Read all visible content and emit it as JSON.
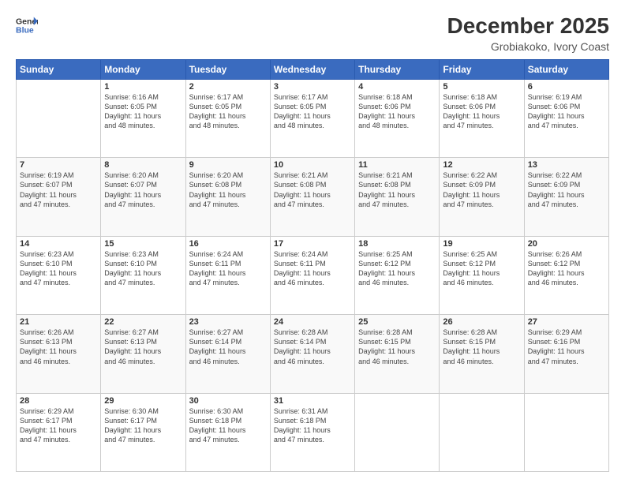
{
  "header": {
    "logo_line1": "General",
    "logo_line2": "Blue",
    "month_year": "December 2025",
    "location": "Grobiakoko, Ivory Coast"
  },
  "weekdays": [
    "Sunday",
    "Monday",
    "Tuesday",
    "Wednesday",
    "Thursday",
    "Friday",
    "Saturday"
  ],
  "weeks": [
    [
      {
        "day": "",
        "info": ""
      },
      {
        "day": "1",
        "info": "Sunrise: 6:16 AM\nSunset: 6:05 PM\nDaylight: 11 hours\nand 48 minutes."
      },
      {
        "day": "2",
        "info": "Sunrise: 6:17 AM\nSunset: 6:05 PM\nDaylight: 11 hours\nand 48 minutes."
      },
      {
        "day": "3",
        "info": "Sunrise: 6:17 AM\nSunset: 6:05 PM\nDaylight: 11 hours\nand 48 minutes."
      },
      {
        "day": "4",
        "info": "Sunrise: 6:18 AM\nSunset: 6:06 PM\nDaylight: 11 hours\nand 48 minutes."
      },
      {
        "day": "5",
        "info": "Sunrise: 6:18 AM\nSunset: 6:06 PM\nDaylight: 11 hours\nand 47 minutes."
      },
      {
        "day": "6",
        "info": "Sunrise: 6:19 AM\nSunset: 6:06 PM\nDaylight: 11 hours\nand 47 minutes."
      }
    ],
    [
      {
        "day": "7",
        "info": "Sunrise: 6:19 AM\nSunset: 6:07 PM\nDaylight: 11 hours\nand 47 minutes."
      },
      {
        "day": "8",
        "info": "Sunrise: 6:20 AM\nSunset: 6:07 PM\nDaylight: 11 hours\nand 47 minutes."
      },
      {
        "day": "9",
        "info": "Sunrise: 6:20 AM\nSunset: 6:08 PM\nDaylight: 11 hours\nand 47 minutes."
      },
      {
        "day": "10",
        "info": "Sunrise: 6:21 AM\nSunset: 6:08 PM\nDaylight: 11 hours\nand 47 minutes."
      },
      {
        "day": "11",
        "info": "Sunrise: 6:21 AM\nSunset: 6:08 PM\nDaylight: 11 hours\nand 47 minutes."
      },
      {
        "day": "12",
        "info": "Sunrise: 6:22 AM\nSunset: 6:09 PM\nDaylight: 11 hours\nand 47 minutes."
      },
      {
        "day": "13",
        "info": "Sunrise: 6:22 AM\nSunset: 6:09 PM\nDaylight: 11 hours\nand 47 minutes."
      }
    ],
    [
      {
        "day": "14",
        "info": "Sunrise: 6:23 AM\nSunset: 6:10 PM\nDaylight: 11 hours\nand 47 minutes."
      },
      {
        "day": "15",
        "info": "Sunrise: 6:23 AM\nSunset: 6:10 PM\nDaylight: 11 hours\nand 47 minutes."
      },
      {
        "day": "16",
        "info": "Sunrise: 6:24 AM\nSunset: 6:11 PM\nDaylight: 11 hours\nand 47 minutes."
      },
      {
        "day": "17",
        "info": "Sunrise: 6:24 AM\nSunset: 6:11 PM\nDaylight: 11 hours\nand 46 minutes."
      },
      {
        "day": "18",
        "info": "Sunrise: 6:25 AM\nSunset: 6:12 PM\nDaylight: 11 hours\nand 46 minutes."
      },
      {
        "day": "19",
        "info": "Sunrise: 6:25 AM\nSunset: 6:12 PM\nDaylight: 11 hours\nand 46 minutes."
      },
      {
        "day": "20",
        "info": "Sunrise: 6:26 AM\nSunset: 6:12 PM\nDaylight: 11 hours\nand 46 minutes."
      }
    ],
    [
      {
        "day": "21",
        "info": "Sunrise: 6:26 AM\nSunset: 6:13 PM\nDaylight: 11 hours\nand 46 minutes."
      },
      {
        "day": "22",
        "info": "Sunrise: 6:27 AM\nSunset: 6:13 PM\nDaylight: 11 hours\nand 46 minutes."
      },
      {
        "day": "23",
        "info": "Sunrise: 6:27 AM\nSunset: 6:14 PM\nDaylight: 11 hours\nand 46 minutes."
      },
      {
        "day": "24",
        "info": "Sunrise: 6:28 AM\nSunset: 6:14 PM\nDaylight: 11 hours\nand 46 minutes."
      },
      {
        "day": "25",
        "info": "Sunrise: 6:28 AM\nSunset: 6:15 PM\nDaylight: 11 hours\nand 46 minutes."
      },
      {
        "day": "26",
        "info": "Sunrise: 6:28 AM\nSunset: 6:15 PM\nDaylight: 11 hours\nand 46 minutes."
      },
      {
        "day": "27",
        "info": "Sunrise: 6:29 AM\nSunset: 6:16 PM\nDaylight: 11 hours\nand 47 minutes."
      }
    ],
    [
      {
        "day": "28",
        "info": "Sunrise: 6:29 AM\nSunset: 6:17 PM\nDaylight: 11 hours\nand 47 minutes."
      },
      {
        "day": "29",
        "info": "Sunrise: 6:30 AM\nSunset: 6:17 PM\nDaylight: 11 hours\nand 47 minutes."
      },
      {
        "day": "30",
        "info": "Sunrise: 6:30 AM\nSunset: 6:18 PM\nDaylight: 11 hours\nand 47 minutes."
      },
      {
        "day": "31",
        "info": "Sunrise: 6:31 AM\nSunset: 6:18 PM\nDaylight: 11 hours\nand 47 minutes."
      },
      {
        "day": "",
        "info": ""
      },
      {
        "day": "",
        "info": ""
      },
      {
        "day": "",
        "info": ""
      }
    ]
  ]
}
